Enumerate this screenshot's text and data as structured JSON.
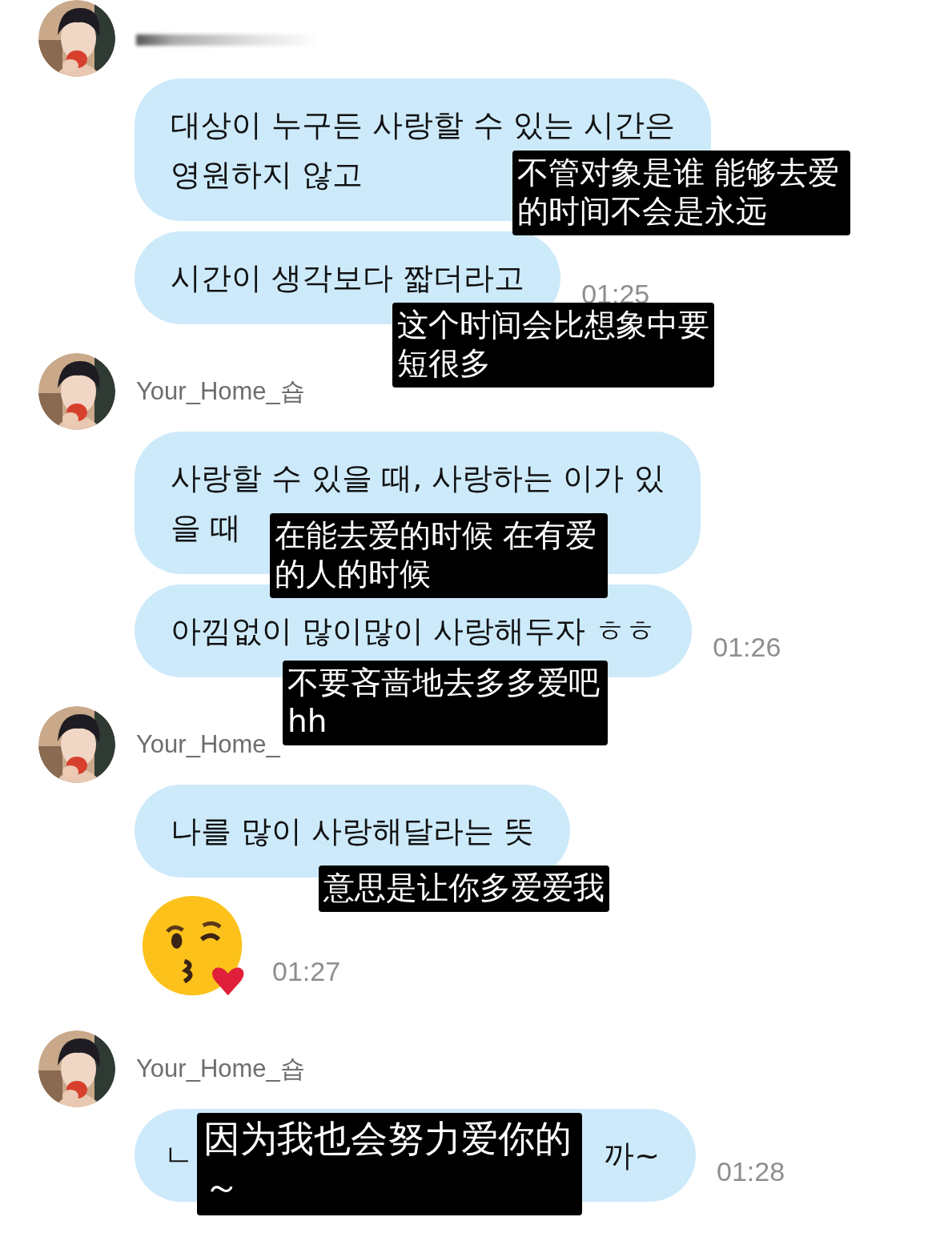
{
  "groups": [
    {
      "sender": {
        "kind": "redacted"
      },
      "messages": [
        {
          "kind": "text",
          "text": "대상이 누구든 사랑할 수 있는 시간은\n영원하지 않고",
          "caption": "不管对象是谁 能够去爱的时间不会是永远"
        },
        {
          "kind": "text",
          "text": "시간이 생각보다 짧더라고",
          "time": "01:25",
          "caption": "这个时间会比想象中要短很多"
        }
      ]
    },
    {
      "sender": {
        "kind": "named",
        "name": "Your_Home_숍"
      },
      "messages": [
        {
          "kind": "text",
          "text": "사랑할 수 있을 때, 사랑하는 이가 있\n을 때",
          "caption": "在能去爱的时候 在有爱的人的时候"
        },
        {
          "kind": "text",
          "text": "아낌없이 많이많이 사랑해두자 ㅎㅎ",
          "time": "01:26",
          "caption": "不要吝啬地去多多爱吧 hh"
        }
      ]
    },
    {
      "sender": {
        "kind": "named",
        "name": "Your_Home_"
      },
      "messages": [
        {
          "kind": "text",
          "text": "나를 많이 사랑해달라는 뜻",
          "caption": "意思是让你多爱爱我"
        },
        {
          "kind": "emoji",
          "time": "01:27"
        }
      ]
    },
    {
      "sender": {
        "kind": "named",
        "name": "Your_Home_숍"
      },
      "messages": [
        {
          "kind": "covered",
          "parts": [
            "ㄴ",
            "까~"
          ],
          "time": "01:28",
          "caption": "因为我也会努力爱你的～"
        }
      ]
    }
  ]
}
